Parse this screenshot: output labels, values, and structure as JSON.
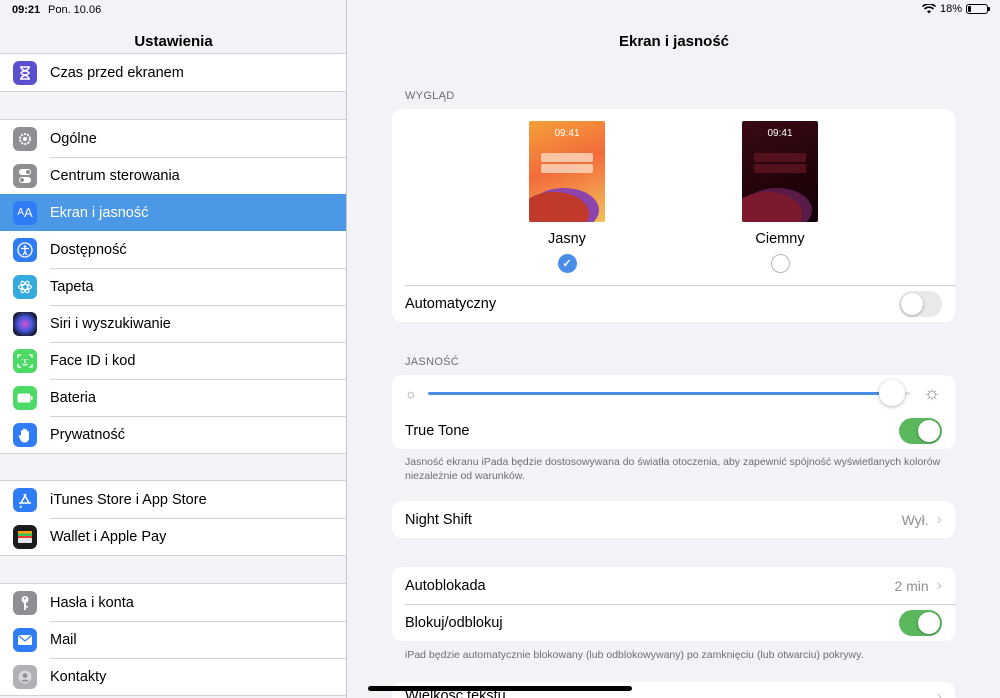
{
  "status_bar": {
    "time": "09:21",
    "date": "Pon. 10.06",
    "battery": "18%",
    "battery_level": 0.18
  },
  "sidebar": {
    "title": "Ustawienia",
    "groups": [
      {
        "items": [
          {
            "label": "Czas przed ekranem",
            "icon": "hourglass-icon",
            "color": "#5b4fcf"
          }
        ]
      },
      {
        "items": [
          {
            "label": "Ogólne",
            "icon": "gear-icon",
            "color": "#8e8e93"
          },
          {
            "label": "Centrum sterowania",
            "icon": "toggles-icon",
            "color": "#8e8e93"
          },
          {
            "label": "Ekran i jasność",
            "icon": "text-size-icon",
            "color": "#2f7cf6",
            "active": true
          },
          {
            "label": "Dostępność",
            "icon": "accessibility-icon",
            "color": "#2f7cf6"
          },
          {
            "label": "Tapeta",
            "icon": "flower-icon",
            "color": "#35aadc"
          },
          {
            "label": "Siri i wyszukiwanie",
            "icon": "siri-icon",
            "color": "#1c1c3a"
          },
          {
            "label": "Face ID i kod",
            "icon": "face-id-icon",
            "color": "#4cd964"
          },
          {
            "label": "Bateria",
            "icon": "battery-icon",
            "color": "#4cd964"
          },
          {
            "label": "Prywatność",
            "icon": "hand-icon",
            "color": "#2f7cf6"
          }
        ]
      },
      {
        "items": [
          {
            "label": "iTunes Store i App Store",
            "icon": "app-store-icon",
            "color": "#2f7cf6"
          },
          {
            "label": "Wallet i Apple Pay",
            "icon": "wallet-icon",
            "color": "#1c1c1e"
          }
        ]
      },
      {
        "items": [
          {
            "label": "Hasła i konta",
            "icon": "key-icon",
            "color": "#8e8e93"
          },
          {
            "label": "Mail",
            "icon": "mail-icon",
            "color": "#2f7cf6"
          },
          {
            "label": "Kontakty",
            "icon": "contacts-icon",
            "color": "#b0b0b5"
          }
        ]
      }
    ]
  },
  "main": {
    "title": "Ekran i jasność",
    "appearance": {
      "header": "WYGLĄD",
      "light": {
        "label": "Jasny",
        "time": "09:41",
        "selected": true
      },
      "dark": {
        "label": "Ciemny",
        "time": "09:41",
        "selected": false
      },
      "automatic": {
        "label": "Automatyczny",
        "on": false
      }
    },
    "brightness": {
      "header": "JASNOŚĆ",
      "level": 0.96,
      "true_tone": {
        "label": "True Tone",
        "on": true
      },
      "footnote": "Jasność ekranu iPada będzie dostosowywana do światła otoczenia, aby zapewnić spójność wyświetlanych kolorów niezależnie od warunków."
    },
    "night_shift": {
      "label": "Night Shift",
      "value": "Wył."
    },
    "autolock": {
      "label": "Autoblokada",
      "value": "2 min"
    },
    "lock_unlock": {
      "label": "Blokuj/odblokuj",
      "on": true,
      "footnote": "iPad będzie automatycznie blokowany (lub odblokowywany) po zamknięciu (lub otwarciu) pokrywy."
    },
    "text_size": {
      "label": "Wielkość tekstu"
    }
  },
  "accent_color": "#4a98e6",
  "toggle_on_color": "#5cb85c"
}
